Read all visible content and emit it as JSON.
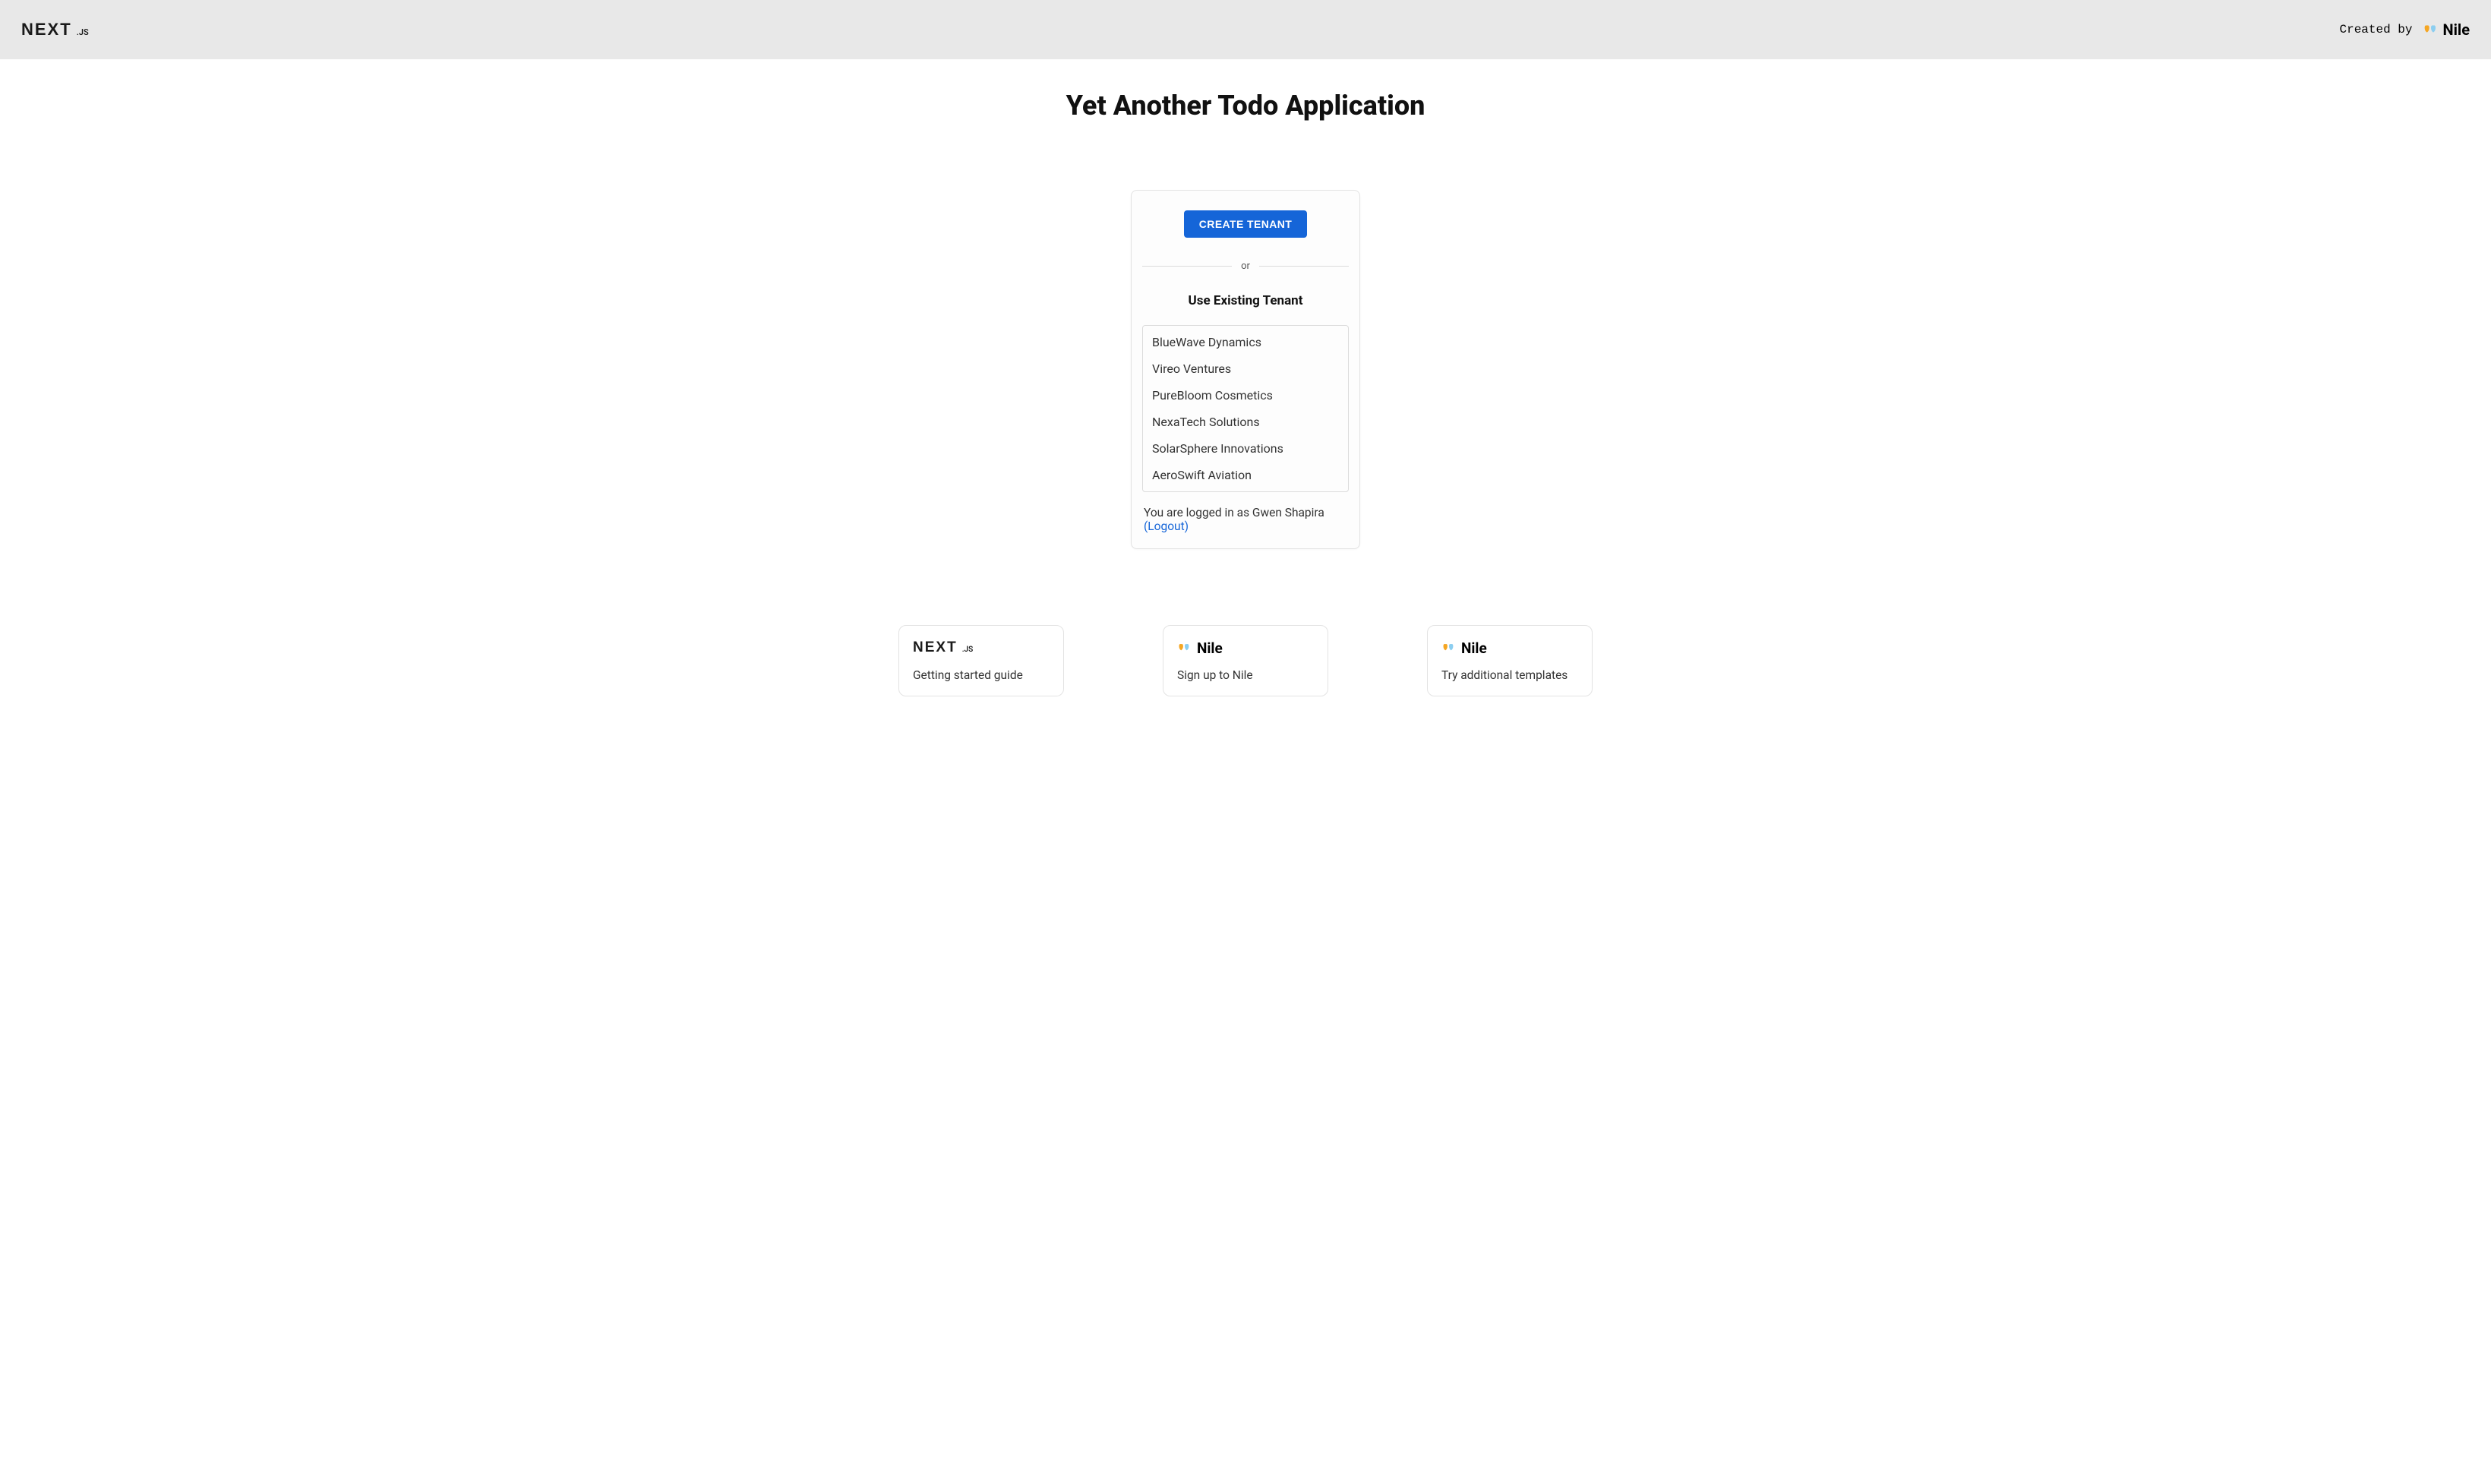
{
  "header": {
    "created_by": "Created by",
    "nextjs_logo_main": "NEXT",
    "nextjs_logo_suffix": ".JS",
    "nile_logo_text": "Nile"
  },
  "page_title": "Yet Another Todo Application",
  "card": {
    "create_button": "CREATE TENANT",
    "divider_text": "or",
    "existing_heading": "Use Existing Tenant",
    "tenants": [
      "BlueWave Dynamics",
      "Vireo Ventures",
      "PureBloom Cosmetics",
      "NexaTech Solutions",
      "SolarSphere Innovations",
      "AeroSwift Aviation"
    ],
    "login_prefix": "You are logged in as ",
    "login_user": "Gwen Shapira",
    "logout_label": " (Logout)"
  },
  "footer": {
    "cards": [
      {
        "logo": "nextjs",
        "text": "Getting started guide"
      },
      {
        "logo": "nile",
        "text": "Sign up to Nile"
      },
      {
        "logo": "nile",
        "text": "Try additional templates"
      }
    ]
  }
}
